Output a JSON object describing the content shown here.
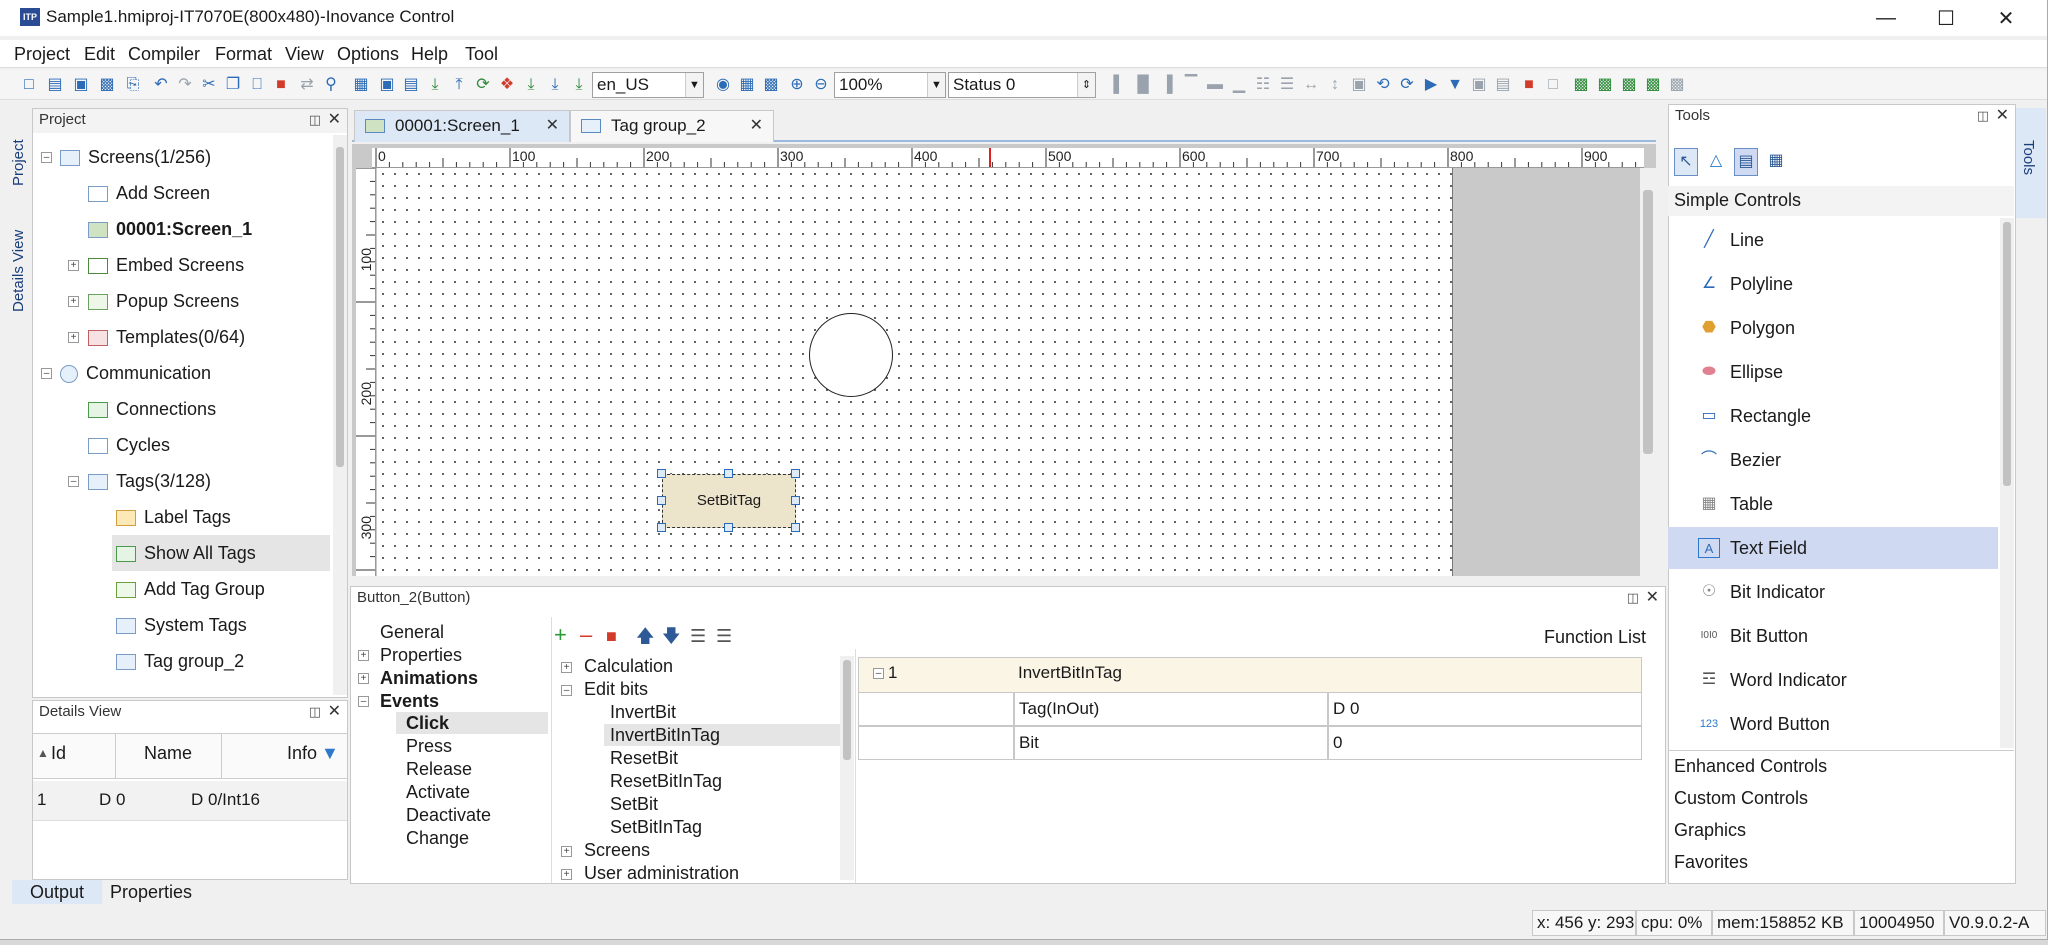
{
  "window": {
    "title": "Sample1.hmiproj-IT7070E(800x480)-Inovance Control",
    "app_icon": "ITP"
  },
  "menu": [
    "Project",
    "Edit",
    "Compiler",
    "Format",
    "View",
    "Options",
    "Help",
    "Tool"
  ],
  "toolbar": {
    "language": "en_US",
    "zoom": "100%",
    "status": "Status 0"
  },
  "project_panel": {
    "title": "Project",
    "vtabs": [
      "Project",
      "Details View"
    ],
    "tree": [
      {
        "label": "Screens(1/256)",
        "icon": "screens-icon"
      },
      {
        "label": "Add Screen",
        "icon": "add-screen-icon"
      },
      {
        "label": "00001:Screen_1",
        "icon": "screen-icon"
      },
      {
        "label": "Embed Screens",
        "icon": "embed-screens-icon"
      },
      {
        "label": "Popup Screens",
        "icon": "popup-screens-icon"
      },
      {
        "label": "Templates(0/64)",
        "icon": "templates-icon"
      },
      {
        "label": "Communication",
        "icon": "globe-icon"
      },
      {
        "label": "Connections",
        "icon": "connections-icon"
      },
      {
        "label": "Cycles",
        "icon": "cycles-icon"
      },
      {
        "label": "Tags(3/128)",
        "icon": "tags-icon"
      },
      {
        "label": "Label Tags",
        "icon": "label-tags-icon"
      },
      {
        "label": "Show All Tags",
        "icon": "show-all-tags-icon"
      },
      {
        "label": "Add Tag Group",
        "icon": "add-tag-group-icon"
      },
      {
        "label": "System Tags",
        "icon": "system-tags-icon"
      },
      {
        "label": "Tag group_2",
        "icon": "tag-group-icon"
      }
    ]
  },
  "details_view": {
    "title": "Details View",
    "columns": [
      "Id",
      "Name",
      "Info"
    ],
    "rows": [
      {
        "id": "1",
        "name": "D 0",
        "info": "D 0/Int16"
      }
    ]
  },
  "bottom_tabs": [
    "Output",
    "Properties"
  ],
  "editor_tabs": [
    {
      "label": "00001:Screen_1",
      "icon": "screen-icon"
    },
    {
      "label": "Tag group_2",
      "icon": "tag-group-icon"
    }
  ],
  "rulers": {
    "h_labels": [
      "0",
      "100",
      "200",
      "300",
      "400",
      "500",
      "600",
      "700",
      "800",
      "900"
    ],
    "v_labels": [
      "100",
      "200",
      "300"
    ]
  },
  "design": {
    "button_text": "SetBitTag"
  },
  "properties_panel": {
    "title": "Button_2(Button)",
    "nav": [
      "General",
      "Properties",
      "Animations",
      "Events",
      "Click",
      "Press",
      "Release",
      "Activate",
      "Deactivate",
      "Change"
    ],
    "functions": [
      "Calculation",
      "Edit bits",
      "InvertBit",
      "InvertBitInTag",
      "ResetBit",
      "ResetBitInTag",
      "SetBit",
      "SetBitInTag",
      "Screens",
      "User administration"
    ],
    "function_list_label": "Function List",
    "grid": {
      "row_num": "1",
      "function": "InvertBitInTag",
      "params": [
        {
          "name": "Tag(InOut)",
          "value": "D 0"
        },
        {
          "name": "Bit",
          "value": "0"
        }
      ]
    }
  },
  "tools_panel": {
    "title": "Tools",
    "vtab": "Tools",
    "category": "Simple Controls",
    "items": [
      {
        "label": "Line",
        "icon": "line-icon"
      },
      {
        "label": "Polyline",
        "icon": "polyline-icon"
      },
      {
        "label": "Polygon",
        "icon": "polygon-icon"
      },
      {
        "label": "Ellipse",
        "icon": "ellipse-icon"
      },
      {
        "label": "Rectangle",
        "icon": "rectangle-icon"
      },
      {
        "label": "Bezier",
        "icon": "bezier-icon"
      },
      {
        "label": "Table",
        "icon": "table-icon"
      },
      {
        "label": "Text Field",
        "icon": "text-field-icon"
      },
      {
        "label": "Bit Indicator",
        "icon": "bit-indicator-icon"
      },
      {
        "label": "Bit Button",
        "icon": "bit-button-icon"
      },
      {
        "label": "Word Indicator",
        "icon": "word-indicator-icon"
      },
      {
        "label": "Word Button",
        "icon": "word-button-icon"
      }
    ],
    "other_categories": [
      "Enhanced Controls",
      "Custom Controls",
      "Graphics",
      "Favorites"
    ]
  },
  "statusbar": {
    "coords": "x: 456 y: 293",
    "cpu": "cpu:  0%",
    "mem": "mem:158852 KB",
    "id": "10004950",
    "version": "V0.9.0.2-A"
  }
}
